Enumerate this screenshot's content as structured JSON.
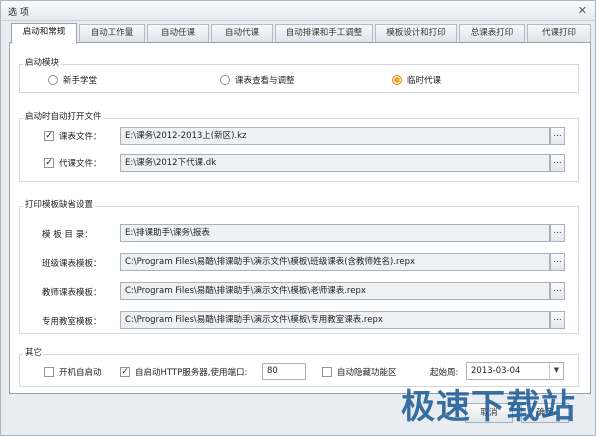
{
  "window": {
    "title": "选 项",
    "close_glyph": "✕"
  },
  "tabs": [
    {
      "label": "启动和常规",
      "active": true
    },
    {
      "label": "自动工作量"
    },
    {
      "label": "自动任课"
    },
    {
      "label": "自动代课"
    },
    {
      "label": "自动排课和手工调整"
    },
    {
      "label": "模板设计和打印"
    },
    {
      "label": "总课表打印"
    },
    {
      "label": "代课打印"
    }
  ],
  "startup_module": {
    "title": "启动模块",
    "options": [
      {
        "label": "新手学堂",
        "selected": false
      },
      {
        "label": "课表查看与调整",
        "selected": false
      },
      {
        "label": "临时代课",
        "selected": true
      }
    ]
  },
  "open_files": {
    "title": "启动时自动打开文件",
    "rows": [
      {
        "label": "课表文件：",
        "checked": true,
        "value": "E:\\课务\\2012-2013上(新区).kz"
      },
      {
        "label": "代课文件：",
        "checked": true,
        "value": "E:\\课务\\2012下代课.dk"
      }
    ]
  },
  "print_templates": {
    "title": "打印模板缺省设置",
    "rows": [
      {
        "label": "模 板 目 录：",
        "value": "E:\\排课助手\\课务\\报表"
      },
      {
        "label": "班级课表模板：",
        "value": "C:\\Program Files\\易酷\\排课助手\\演示文件\\模板\\班级课表(含教师姓名).repx"
      },
      {
        "label": "教师课表模板：",
        "value": "C:\\Program Files\\易酷\\排课助手\\演示文件\\模板\\老师课表.repx"
      },
      {
        "label": "专用教室模板：",
        "value": "C:\\Program Files\\易酷\\排课助手\\演示文件\\模板\\专用教室课表.repx"
      }
    ],
    "browse_glyph": "..."
  },
  "other": {
    "title": "其它",
    "auto_start": {
      "label": "开机自启动",
      "checked": false
    },
    "http_server": {
      "label": "自启动HTTP服务器,使用端口:",
      "checked": true,
      "port": "80"
    },
    "hide_ribbon": {
      "label": "自动隐藏功能区",
      "checked": false
    },
    "start_week": {
      "label": "起始周:",
      "value": "2013-03-04",
      "arrow": "▼"
    }
  },
  "footer": {
    "cancel_label": "取消",
    "ok_label": "确定"
  },
  "watermark": "极速下载站",
  "colors": {
    "accent_radio": "#f5a21b",
    "watermark": "#1f5d97",
    "panel_bg": "#ffffff",
    "window_bg": "#e9edf2"
  }
}
